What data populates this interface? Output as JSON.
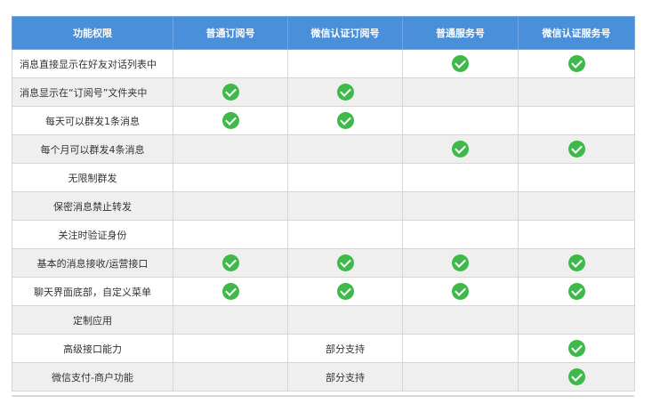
{
  "headers": [
    "功能权限",
    "普通订阅号",
    "微信认证订阅号",
    "普通服务号",
    "微信认证服务号"
  ],
  "rows": [
    {
      "feature": "消息直接显示在好友对话列表中",
      "cells": [
        "",
        "",
        "check",
        "check"
      ],
      "align": "left"
    },
    {
      "feature": "消息显示在“订阅号”文件夹中",
      "cells": [
        "check",
        "check",
        "",
        ""
      ],
      "align": "left"
    },
    {
      "feature": "每天可以群发1条消息",
      "cells": [
        "check",
        "check",
        "",
        ""
      ],
      "align": "center"
    },
    {
      "feature": "每个月可以群发4条消息",
      "cells": [
        "",
        "",
        "check",
        "check"
      ],
      "align": "center"
    },
    {
      "feature": "无限制群发",
      "cells": [
        "",
        "",
        "",
        ""
      ],
      "align": "center"
    },
    {
      "feature": "保密消息禁止转发",
      "cells": [
        "",
        "",
        "",
        ""
      ],
      "align": "center"
    },
    {
      "feature": "关注时验证身份",
      "cells": [
        "",
        "",
        "",
        ""
      ],
      "align": "center"
    },
    {
      "feature": "基本的消息接收/运营接口",
      "cells": [
        "check",
        "check",
        "check",
        "check"
      ],
      "align": "center"
    },
    {
      "feature": "聊天界面底部，自定义菜单",
      "cells": [
        "check",
        "check",
        "check",
        "check"
      ],
      "align": "center"
    },
    {
      "feature": "定制应用",
      "cells": [
        "",
        "",
        "",
        ""
      ],
      "align": "center"
    },
    {
      "feature": "高级接口能力",
      "cells": [
        "",
        "部分支持",
        "",
        "check"
      ],
      "align": "center"
    },
    {
      "feature": "微信支付-商户功能",
      "cells": [
        "",
        "部分支持",
        "",
        "check"
      ],
      "align": "center"
    }
  ],
  "icons": {
    "check": "check-circle-icon"
  },
  "colors": {
    "header_bg": "#4a8fd9",
    "check_green": "#3fb94a",
    "row_alt": "#efefef"
  }
}
